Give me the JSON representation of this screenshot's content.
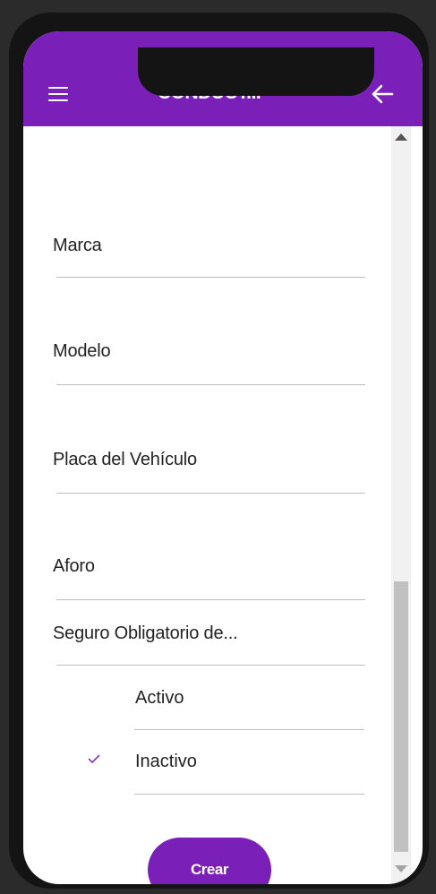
{
  "header": {
    "title": "CONDUCT...",
    "menu_icon": "hamburger-menu-icon",
    "back_icon": "arrow-left-icon",
    "color": "#7a20b9"
  },
  "form": {
    "fields": [
      {
        "label": "Marca"
      },
      {
        "label": "Modelo"
      },
      {
        "label": "Placa del Vehículo"
      },
      {
        "label": "Aforo"
      }
    ],
    "insurance_select": {
      "label": "Seguro Obligatorio de...",
      "options": [
        {
          "label": "Activo",
          "selected": false
        },
        {
          "label": "Inactivo",
          "selected": true
        }
      ]
    },
    "submit_label": "Crear"
  },
  "scrollbar": {
    "up_icon": "scroll-up-arrow-icon",
    "down_icon": "scroll-down-arrow-icon"
  }
}
